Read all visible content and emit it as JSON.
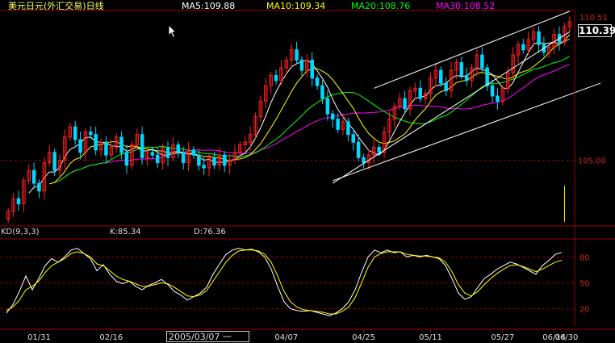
{
  "header": {
    "title": "美元日元(外汇交易)日线",
    "ma5": "MA5:109.88",
    "ma10": "MA10:109.34",
    "ma20": "MA20:108.76",
    "ma30": "MA30:108.52"
  },
  "colors": {
    "up": "#ff2020",
    "down": "#00d8ff",
    "ma5": "#ffffff",
    "ma10": "#ffff00",
    "ma20": "#00ff00",
    "ma30": "#ff00ff",
    "grid": "#a00000",
    "axis": "#a00000"
  },
  "price_axis": {
    "label_105": "105.00",
    "label_high": "110.51",
    "current": "110.39"
  },
  "kd_panel": {
    "title": "KD(9,3,3)",
    "k_label": "K:85.34",
    "d_label": "D:76.36",
    "levels": [
      "80",
      "50",
      "20"
    ]
  },
  "x_axis": {
    "date_box": "2005/03/07 一",
    "ticks": [
      "01/31",
      "02/16",
      "03/",
      "04/07",
      "04/25",
      "05/11",
      "05/27",
      "06/14",
      "06/30"
    ]
  },
  "chart_data": [
    {
      "type": "candlestick",
      "title": "美元日元(外汇交易)日线",
      "yticks": [
        105.0
      ],
      "ylim": [
        102.5,
        110.8
      ],
      "close": [
        103.0,
        103.5,
        103.3,
        104.2,
        104.6,
        104.1,
        103.8,
        104.9,
        105.3,
        104.6,
        105.0,
        105.9,
        106.3,
        105.8,
        105.3,
        106.1,
        106.0,
        105.4,
        105.7,
        105.2,
        105.5,
        105.9,
        105.3,
        104.8,
        105.6,
        106.0,
        105.1,
        105.3,
        105.2,
        104.9,
        105.5,
        105.1,
        105.6,
        105.3,
        104.9,
        105.4,
        105.2,
        104.8,
        104.7,
        105.1,
        104.8,
        105.2,
        104.8,
        105.0,
        105.3,
        105.6,
        105.7,
        106.0,
        106.7,
        107.3,
        107.9,
        108.3,
        108.1,
        108.6,
        108.9,
        109.3,
        108.9,
        108.5,
        108.9,
        108.2,
        107.9,
        107.4,
        106.8,
        106.6,
        106.2,
        106.5,
        106.0,
        105.7,
        105.1,
        104.9,
        105.2,
        105.5,
        105.3,
        106.1,
        106.6,
        107.1,
        107.4,
        107.0,
        107.7,
        107.8,
        107.4,
        107.6,
        108.2,
        108.5,
        108.0,
        107.7,
        108.5,
        108.8,
        108.3,
        108.1,
        108.6,
        109.1,
        108.6,
        107.9,
        107.5,
        107.3,
        107.8,
        108.4,
        109.1,
        109.5,
        109.3,
        109.7,
        110.0,
        109.5,
        109.2,
        109.4,
        109.9,
        109.6,
        110.2,
        110.39
      ],
      "candles_shown": 110,
      "moving_averages": [
        "MA5",
        "MA10",
        "MA20",
        "MA30"
      ],
      "channel_lines": 4
    },
    {
      "type": "line",
      "title": "KD(9,3,3)",
      "ylim": [
        0,
        100
      ],
      "yticks": [
        20,
        50,
        80
      ],
      "series": [
        {
          "name": "K",
          "values": [
            15,
            25,
            40,
            58,
            42,
            55,
            70,
            78,
            74,
            80,
            88,
            90,
            84,
            78,
            64,
            71,
            60,
            52,
            49,
            52,
            46,
            42,
            47,
            50,
            54,
            48,
            40,
            36,
            30,
            34,
            38,
            45,
            60,
            72,
            83,
            88,
            90,
            88,
            89,
            86,
            80,
            66,
            46,
            28,
            20,
            18,
            17,
            18,
            16,
            14,
            12,
            15,
            20,
            28,
            42,
            62,
            80,
            88,
            85,
            88,
            85,
            86,
            80,
            82,
            80,
            82,
            80,
            78,
            70,
            55,
            38,
            31,
            34,
            45,
            55,
            60,
            66,
            70,
            74,
            72,
            68,
            64,
            60,
            70,
            76,
            83,
            85.34
          ]
        },
        {
          "name": "D",
          "values": [
            18,
            22,
            30,
            42,
            46,
            52,
            62,
            70,
            74,
            78,
            84,
            86,
            84,
            80,
            72,
            70,
            64,
            58,
            54,
            52,
            49,
            46,
            46,
            48,
            50,
            49,
            45,
            40,
            35,
            34,
            36,
            41,
            52,
            63,
            74,
            82,
            87,
            88,
            88,
            87,
            83,
            74,
            58,
            40,
            28,
            22,
            19,
            18,
            17,
            16,
            14,
            14,
            17,
            22,
            33,
            50,
            68,
            80,
            84,
            86,
            86,
            86,
            83,
            82,
            81,
            81,
            80,
            79,
            74,
            63,
            48,
            38,
            35,
            40,
            48,
            55,
            61,
            66,
            70,
            71,
            69,
            66,
            63,
            66,
            70,
            74,
            76.36
          ]
        }
      ]
    }
  ]
}
